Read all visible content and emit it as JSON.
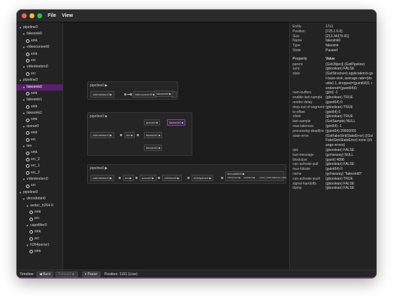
{
  "window": {
    "lights": [
      "#ff5f57",
      "#febc2e",
      "#28c840"
    ]
  },
  "menu": [
    "File",
    "View"
  ],
  "tree": [
    {
      "t": "tri",
      "d": 0,
      "l": "pipeline0"
    },
    {
      "t": "tri",
      "d": 1,
      "l": "fakesink0"
    },
    {
      "t": "pad",
      "d": 2,
      "l": "sink"
    },
    {
      "t": "tri",
      "d": 1,
      "l": "videoconvert0"
    },
    {
      "t": "pad",
      "d": 2,
      "l": "sink"
    },
    {
      "t": "pad",
      "d": 2,
      "l": "src"
    },
    {
      "t": "tri",
      "d": 1,
      "l": "videotestsrc0"
    },
    {
      "t": "pad",
      "d": 2,
      "l": "src"
    },
    {
      "t": "tri",
      "d": 0,
      "l": "pipeline0"
    },
    {
      "t": "tri",
      "d": 1,
      "l": "fakesink0",
      "sel": true
    },
    {
      "t": "pad",
      "d": 2,
      "l": "sink"
    },
    {
      "t": "tri",
      "d": 1,
      "l": "fakesink1"
    },
    {
      "t": "pad",
      "d": 2,
      "l": "sink"
    },
    {
      "t": "tri",
      "d": 1,
      "l": "fakesink2"
    },
    {
      "t": "pad",
      "d": 2,
      "l": "sink"
    },
    {
      "t": "tri",
      "d": 1,
      "l": "queue0"
    },
    {
      "t": "pad",
      "d": 2,
      "l": "sink"
    },
    {
      "t": "pad",
      "d": 2,
      "l": "src"
    },
    {
      "t": "tri",
      "d": 1,
      "l": "tee"
    },
    {
      "t": "pad",
      "d": 2,
      "l": "sink"
    },
    {
      "t": "pad",
      "d": 2,
      "l": "src_0"
    },
    {
      "t": "pad",
      "d": 2,
      "l": "src_1"
    },
    {
      "t": "pad",
      "d": 2,
      "l": "src_2"
    },
    {
      "t": "tri",
      "d": 1,
      "l": "videotestsrc0"
    },
    {
      "t": "pad",
      "d": 2,
      "l": "src"
    },
    {
      "t": "tri",
      "d": 0,
      "l": "pipeline0"
    },
    {
      "t": "tri",
      "d": 1,
      "l": "decodebin0"
    },
    {
      "t": "tri",
      "d": 2,
      "l": "avdec_h264-0"
    },
    {
      "t": "pad",
      "d": 3,
      "l": "sink"
    },
    {
      "t": "pad",
      "d": 3,
      "l": "src"
    },
    {
      "t": "tri",
      "d": 2,
      "l": "capsfilter0"
    },
    {
      "t": "pad",
      "d": 3,
      "l": "sink"
    },
    {
      "t": "pad",
      "d": 3,
      "l": "src"
    },
    {
      "t": "tri",
      "d": 2,
      "l": "h264parse1"
    },
    {
      "t": "pad",
      "d": 3,
      "l": "sink"
    }
  ],
  "canvas": {
    "bin1": {
      "title": "pipeline0 ▶",
      "elements": [
        "videotestsrc0 ▶",
        "videoconvert0 ▶",
        "fakesink0 ▶"
      ]
    },
    "bin2": {
      "title": "pipeline0 ■",
      "elements": [
        "videotestsrc0 ▶",
        "tee ■",
        "queue0 ■",
        "fakesink0 ■",
        "fakesink1 ■",
        "fakesink2 ■"
      ]
    },
    "bin3": {
      "title": "pipeline0 ▶",
      "elements": [
        "videotestsrc0 ▶",
        "tee ▶",
        "queue0 ▶",
        "x264enc0 ▶",
        "h264parse0 ▶",
        "decodebin0 ▶",
        "h264parse1 ▶",
        "capsfilter0 ▶",
        "avdec_h264-0 ▶",
        "avdec_h264"
      ]
    }
  },
  "props": {
    "info": [
      {
        "k": "Entity",
        "v": "17v1"
      },
      {
        "k": "Position",
        "v": "[725.1 0.0]"
      },
      {
        "k": "Size",
        "v": "[213.34375 81]"
      },
      {
        "k": "Name",
        "v": "fakesink0"
      },
      {
        "k": "Type",
        "v": "fakesink"
      },
      {
        "k": "State",
        "v": "Paused"
      }
    ],
    "header": {
      "k": "Property",
      "v": "Value"
    },
    "rows": [
      {
        "k": "parent",
        "v": "(GstObject) (GstPipeline)"
      },
      {
        "k": "sync",
        "v": "(gboolean) FALSE"
      },
      {
        "k": "stats",
        "v": "(GstStructure) application/x-gst-base-sink, average-rate=(double)-1, dropped=(guint64)0, rendered=(guint64)0;"
      },
      {
        "k": "num-buffers",
        "v": "(gint) -1"
      },
      {
        "k": "enable-last-sample",
        "v": "(gboolean) TRUE"
      },
      {
        "k": "render-delay",
        "v": "(guint64) 0"
      },
      {
        "k": "drop-out-of-segment",
        "v": "(gboolean) TRUE"
      },
      {
        "k": "ts-offset",
        "v": "(gint64) 0"
      },
      {
        "k": "silent",
        "v": "(gboolean) TRUE"
      },
      {
        "k": "last-sample",
        "v": "(GstSample) NULL"
      },
      {
        "k": "max-lateness",
        "v": "(gint64) -1"
      },
      {
        "k": "processing-deadline",
        "v": "(guint64) 20000000"
      },
      {
        "k": "state-error",
        "v": "(GstFakeSinkStateError) ((GstFakeSinkStateError) none (change errors)"
      },
      {
        "k": "qos",
        "v": "(gboolean) FALSE"
      },
      {
        "k": "last-message",
        "v": "(gchararay) NULL"
      },
      {
        "k": "blocksize",
        "v": "(guint) 4096"
      },
      {
        "k": "can-activate-pull",
        "v": "(gboolean) FALSE"
      },
      {
        "k": "max-bitrate",
        "v": "(guint64) 0"
      },
      {
        "k": "name",
        "v": "(gchararay) \"fakesink0\""
      },
      {
        "k": "can-activate-push",
        "v": "(gboolean) TRUE"
      },
      {
        "k": "signal-handoffs",
        "v": "(gboolean) FALSE"
      },
      {
        "k": "dump",
        "v": "(gboolean) FALSE"
      }
    ]
  },
  "bottom": {
    "timeline_label": "Timeline:",
    "back_label": "◀ Back",
    "forward_label": "Forward ▶",
    "pause_label": "⏸ Pause",
    "position_label": "Position: 1151 (Live)"
  },
  "colors": {
    "accent": "#7a2d98",
    "selection": "#5a1f6e"
  }
}
